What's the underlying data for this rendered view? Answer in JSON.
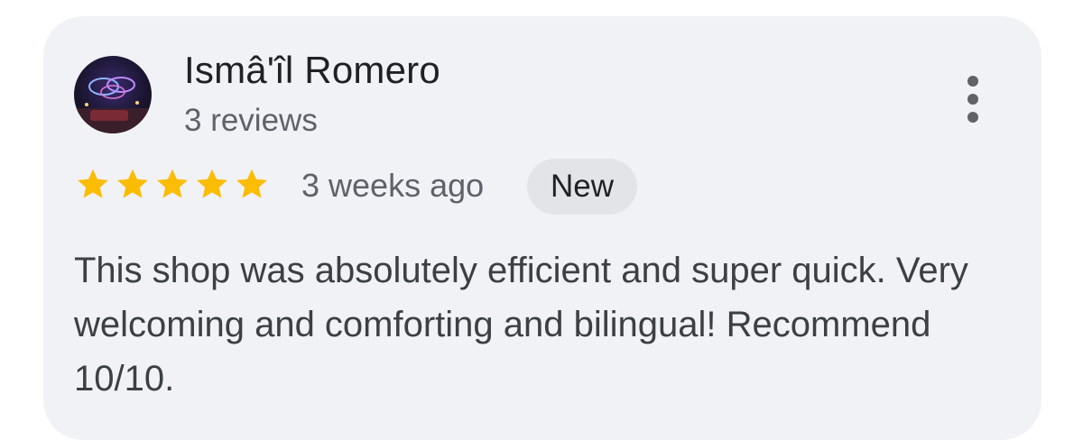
{
  "review": {
    "author_name": "Ismâ'îl Romero",
    "review_count": "3 reviews",
    "rating": 5,
    "rating_max": 5,
    "time_ago": "3 weeks ago",
    "badge": "New",
    "text": "This shop was absolutely efficient and super quick. Very welcoming and comforting and bilingual! Recommend 10/10."
  },
  "icons": {
    "more": "more-vert-icon",
    "star": "star-icon"
  },
  "colors": {
    "card_background": "#f1f2f6",
    "star": "#fbbc04",
    "badge_background": "#e3e4e8",
    "primary_text": "#202124",
    "secondary_text": "#5f6368"
  }
}
